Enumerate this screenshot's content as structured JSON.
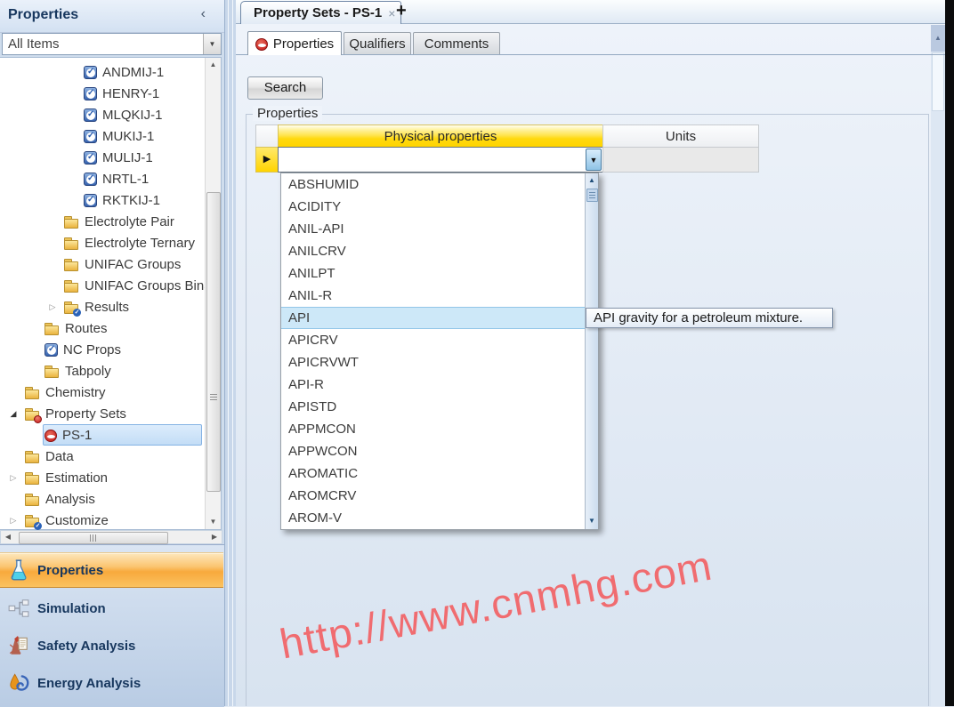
{
  "left_panel": {
    "title": "Properties",
    "collapse_icon": "‹",
    "filter": {
      "value": "All Items",
      "dropdown_icon": "▼"
    },
    "tree": [
      {
        "label": "ANDMIJ-1",
        "icon": "check",
        "level": 3
      },
      {
        "label": "HENRY-1",
        "icon": "check",
        "level": 3
      },
      {
        "label": "MLQKIJ-1",
        "icon": "check",
        "level": 3
      },
      {
        "label": "MUKIJ-1",
        "icon": "check",
        "level": 3
      },
      {
        "label": "MULIJ-1",
        "icon": "check",
        "level": 3
      },
      {
        "label": "NRTL-1",
        "icon": "check",
        "level": 3
      },
      {
        "label": "RKTKIJ-1",
        "icon": "check",
        "level": 3
      },
      {
        "label": "Electrolyte Pair",
        "icon": "folder",
        "level": 2
      },
      {
        "label": "Electrolyte Ternary",
        "icon": "folder",
        "level": 2
      },
      {
        "label": "UNIFAC Groups",
        "icon": "folder",
        "level": 2
      },
      {
        "label": "UNIFAC Groups Bina",
        "icon": "folder",
        "level": 2
      },
      {
        "label": "Results",
        "icon": "folder-check",
        "level": 2,
        "expander": "collapsed"
      },
      {
        "label": "Routes",
        "icon": "folder",
        "level": 1
      },
      {
        "label": "NC Props",
        "icon": "check",
        "level": 1
      },
      {
        "label": "Tabpoly",
        "icon": "folder",
        "level": 1
      },
      {
        "label": "Chemistry",
        "icon": "folder",
        "level": 0
      },
      {
        "label": "Property Sets",
        "icon": "folder-red",
        "level": 0,
        "expander": "expanded"
      },
      {
        "label": "PS-1",
        "icon": "propset",
        "level": 1,
        "selected": true
      },
      {
        "label": "Data",
        "icon": "folder",
        "level": 0
      },
      {
        "label": "Estimation",
        "icon": "folder",
        "level": 0,
        "expander": "collapsed"
      },
      {
        "label": "Analysis",
        "icon": "folder",
        "level": 0
      },
      {
        "label": "Customize",
        "icon": "folder-check",
        "level": 0,
        "expander": "collapsed"
      }
    ],
    "nav": [
      {
        "label": "Properties",
        "icon": "flask-icon",
        "active": true
      },
      {
        "label": "Simulation",
        "icon": "flowsheet-icon",
        "active": false
      },
      {
        "label": "Safety Analysis",
        "icon": "safety-icon",
        "active": false
      },
      {
        "label": "Energy Analysis",
        "icon": "energy-icon",
        "active": false
      }
    ]
  },
  "main": {
    "document_tab": {
      "title": "Property Sets - PS-1",
      "close_icon": "×",
      "new_tab_icon": "+"
    },
    "tabs": [
      {
        "label": "Properties",
        "active": true
      },
      {
        "label": "Qualifiers",
        "active": false
      },
      {
        "label": "Comments",
        "active": false
      }
    ],
    "search_button": "Search",
    "group_title": "Properties",
    "table": {
      "columns": [
        "Physical properties",
        "Units"
      ],
      "row_marker": "▶",
      "combo_arrow": "▼",
      "combo_value": "",
      "units_value": ""
    },
    "dropdown": {
      "items": [
        "ABSHUMID",
        "ACIDITY",
        "ANIL-API",
        "ANILCRV",
        "ANILPT",
        "ANIL-R",
        "API",
        "APICRV",
        "APICRVWT",
        "API-R",
        "APISTD",
        "APPMCON",
        "APPWCON",
        "AROMATIC",
        "AROMCRV",
        "AROM-V"
      ],
      "selected": "API"
    },
    "tooltip": "API gravity for a petroleum mixture."
  },
  "watermark": "http://www.cnmhg.com",
  "colors": {
    "accent_orange": "#f8a93c",
    "header_yellow": "#ffd400",
    "dropdown_highlight": "#cde8f8",
    "tree_selection": "#c3ddf6",
    "title_navy": "#17375e",
    "watermark_red": "#f4575a"
  }
}
